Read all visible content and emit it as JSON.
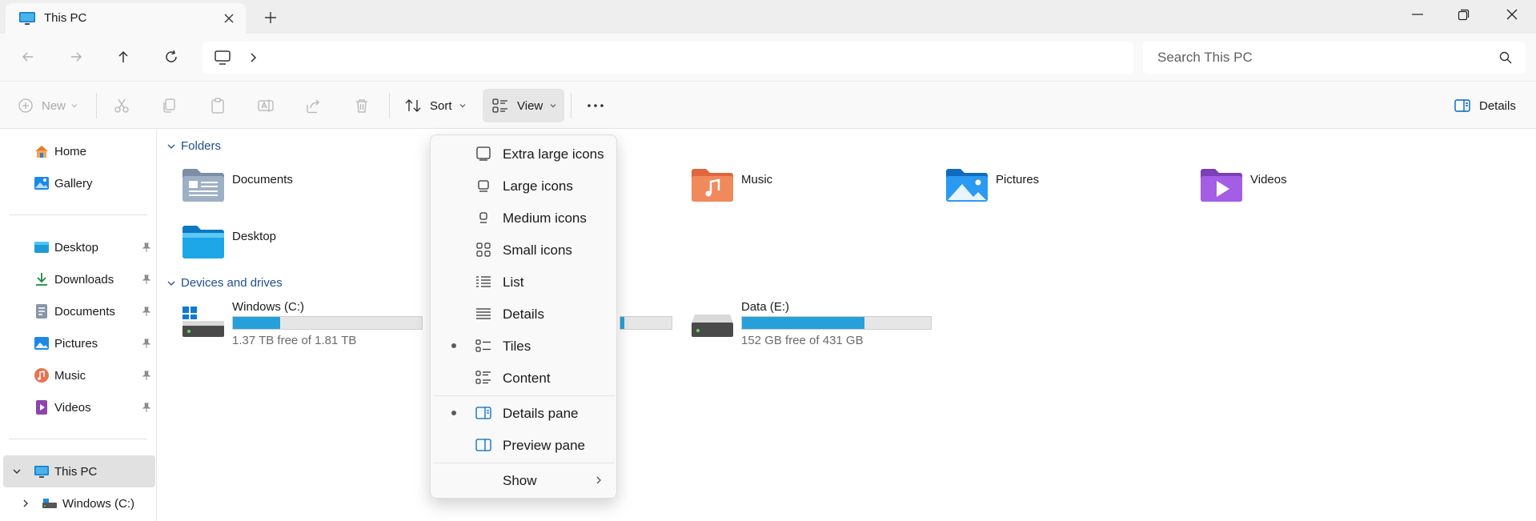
{
  "window": {
    "tab_title": "This PC",
    "tab_icon": "monitor-icon",
    "controls": [
      "minimize-icon",
      "restore-icon",
      "close-icon"
    ]
  },
  "addressbar": {
    "location_icon": "monitor-icon",
    "search_placeholder": "Search This PC"
  },
  "toolbar": {
    "new_label": "New",
    "sort_label": "Sort",
    "view_label": "View",
    "details_label": "Details"
  },
  "sidebar": {
    "items": [
      {
        "label": "Home",
        "icon": "home-icon"
      },
      {
        "label": "Gallery",
        "icon": "gallery-icon"
      },
      {
        "label": "Desktop",
        "icon": "desktop-icon",
        "pinned": true
      },
      {
        "label": "Downloads",
        "icon": "download-icon",
        "pinned": true
      },
      {
        "label": "Documents",
        "icon": "documents-icon",
        "pinned": true
      },
      {
        "label": "Pictures",
        "icon": "pictures-icon",
        "pinned": true
      },
      {
        "label": "Music",
        "icon": "music-icon",
        "pinned": true
      },
      {
        "label": "Videos",
        "icon": "videos-icon",
        "pinned": true
      },
      {
        "label": "This PC",
        "icon": "monitor-icon",
        "selected": true
      },
      {
        "label": "Windows (C:)",
        "icon": "drive-icon"
      }
    ]
  },
  "main": {
    "folders_header": "Folders",
    "folders": [
      {
        "label": "Documents"
      },
      {
        "label": "Music"
      },
      {
        "label": "Pictures"
      },
      {
        "label": "Videos"
      },
      {
        "label": "Desktop"
      }
    ],
    "drives_header": "Devices and drives",
    "drives": [
      {
        "name": "Windows (C:)",
        "free": "1.37 TB free of 1.81 TB",
        "used_fraction": 0.25
      },
      {
        "name": "Data (E:)",
        "free": "152 GB free of 431 GB",
        "used_fraction": 0.65
      }
    ]
  },
  "view_menu": {
    "items": [
      {
        "label": "Extra large icons",
        "icon": "extra-large-icons-icon"
      },
      {
        "label": "Large icons",
        "icon": "large-icons-icon"
      },
      {
        "label": "Medium icons",
        "icon": "medium-icons-icon"
      },
      {
        "label": "Small icons",
        "icon": "small-icons-icon"
      },
      {
        "label": "List",
        "icon": "list-icon"
      },
      {
        "label": "Details",
        "icon": "details-view-icon"
      },
      {
        "label": "Tiles",
        "icon": "tiles-icon",
        "checked": true
      },
      {
        "label": "Content",
        "icon": "content-icon"
      },
      {
        "label": "Details pane",
        "icon": "details-pane-icon",
        "checked": true
      },
      {
        "label": "Preview pane",
        "icon": "preview-pane-icon"
      },
      {
        "label": "Show",
        "submenu": true
      }
    ]
  },
  "colors": {
    "accent": "#005fb8",
    "drive_bar": "#26a0da",
    "section_header": "#1f4e8c"
  }
}
